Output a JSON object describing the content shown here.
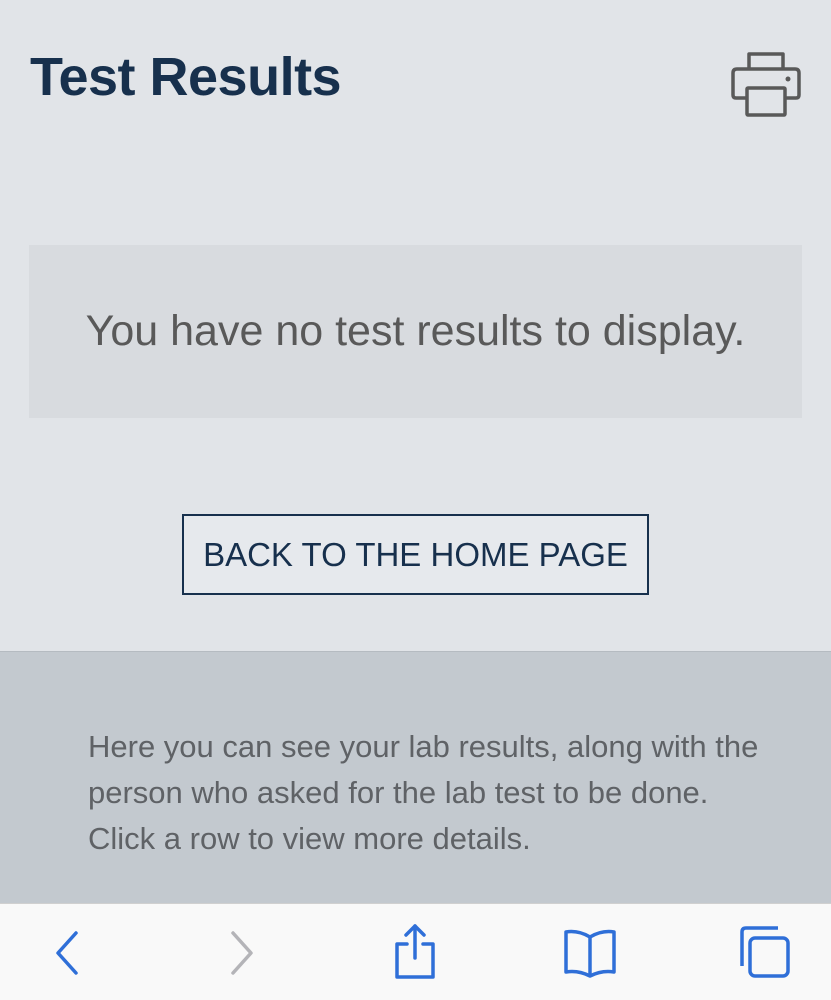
{
  "header": {
    "title": "Test Results",
    "print_icon": "printer-icon"
  },
  "results": {
    "empty_message": "You have no test results to display."
  },
  "actions": {
    "home_label": "BACK TO THE HOME PAGE"
  },
  "info": {
    "text": "Here you can see your lab results, along with the person who asked for the lab test to be done. Click a row to view more details."
  },
  "browser_toolbar": {
    "icons": [
      "back-icon",
      "forward-icon",
      "share-icon",
      "bookmarks-icon",
      "tabs-icon"
    ],
    "accent": "#2f6fd8",
    "disabled": "#b4b4b8"
  },
  "colors": {
    "title": "#17304d",
    "background": "#e1e4e8",
    "info_background": "#c3c9cf"
  }
}
